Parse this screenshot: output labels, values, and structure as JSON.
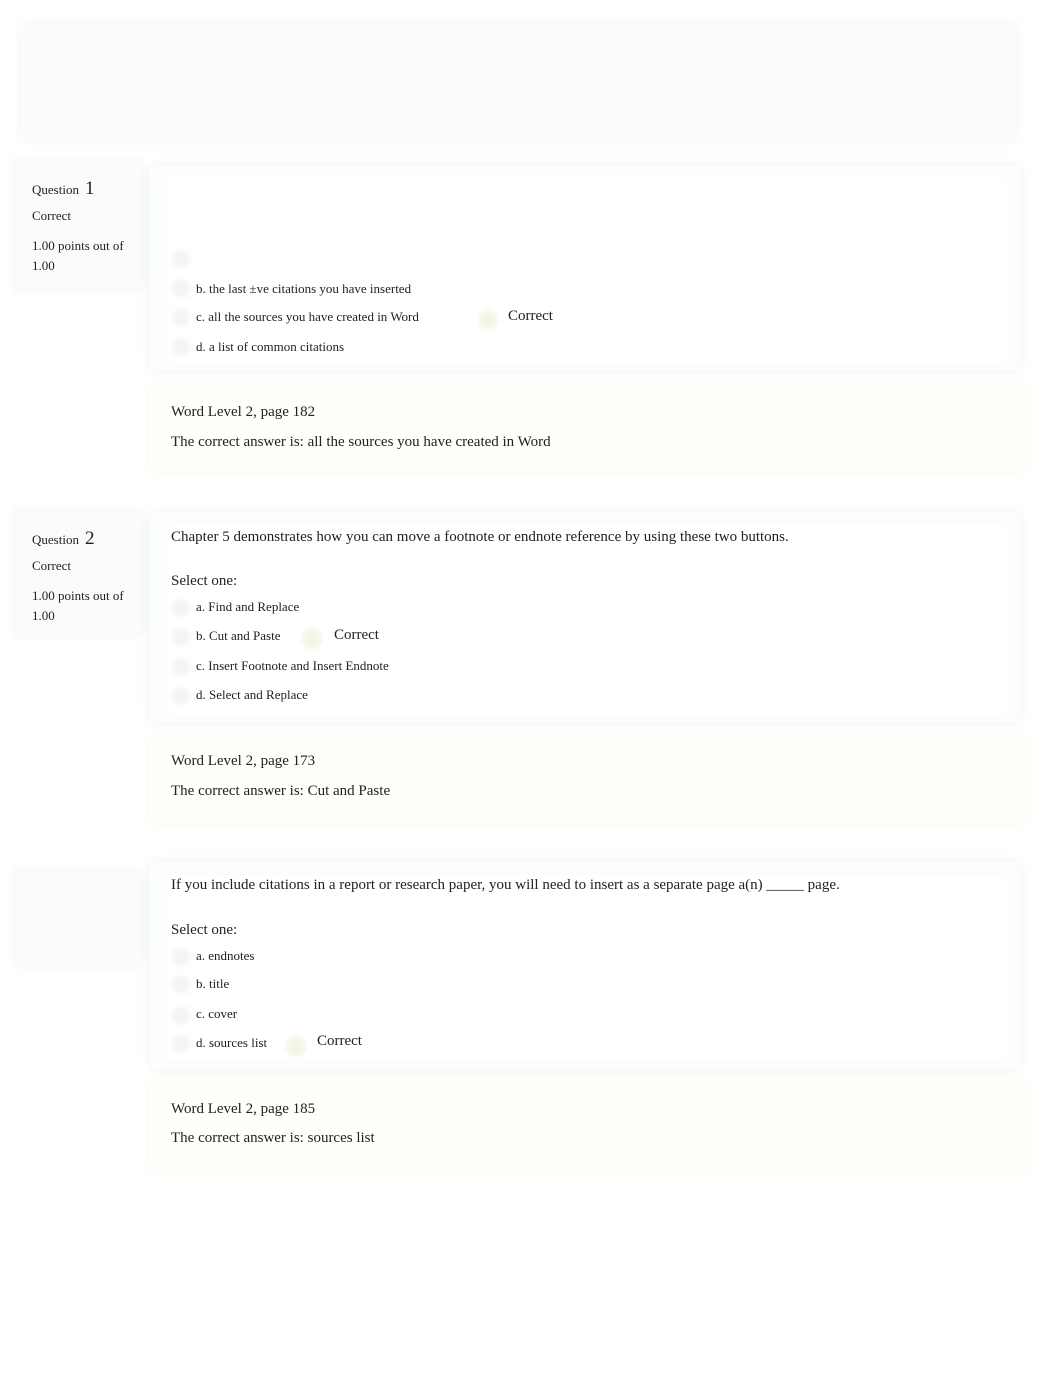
{
  "questions": [
    {
      "label": "Question",
      "number": "1",
      "state": "Correct",
      "grade": "1.00 points out of 1.00",
      "text": "",
      "select": "",
      "options": [
        "b. the last ±ve citations you have inserted",
        "c. all the sources you have created in Word",
        "d. a list of common citations"
      ],
      "correct_mark": "Correct",
      "ref": "Word Level 2, page 182",
      "answer": "The correct answer is: all the sources you have created in Word"
    },
    {
      "label": "Question",
      "number": "2",
      "state": "Correct",
      "grade": "1.00 points out of 1.00",
      "text": "Chapter 5 demonstrates how you can move a footnote or endnote reference by using these two buttons.",
      "select": "Select one:",
      "options": [
        "a. Find and Replace",
        "b. Cut and Paste",
        "c. Insert Footnote and Insert Endnote",
        "d. Select and Replace"
      ],
      "correct_mark": "Correct",
      "ref": "Word Level 2, page 173",
      "answer": "The correct answer is: Cut and Paste"
    },
    {
      "text": "If you include citations in a report or research paper, you will need to insert as a separate page a(n) _____ page.",
      "select": "Select one:",
      "options": [
        "a. endnotes",
        "b. title",
        "c. cover",
        "d. sources list"
      ],
      "correct_mark": "Correct",
      "ref": "Word Level 2, page 185",
      "answer": "The correct answer is: sources list"
    }
  ]
}
